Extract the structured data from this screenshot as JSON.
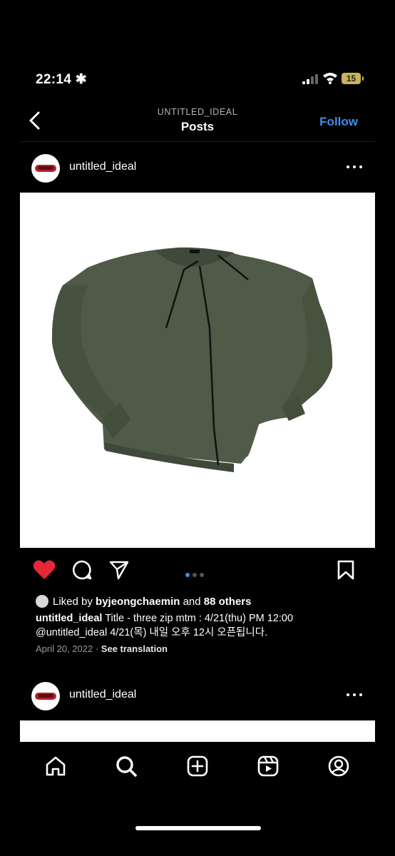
{
  "status_bar": {
    "time": "22:14",
    "battery": "15"
  },
  "header": {
    "account_label": "UNTITLED_IDEAL",
    "title": "Posts",
    "follow_label": "Follow"
  },
  "post": {
    "username": "untitled_ideal",
    "carousel": {
      "count": 3,
      "active_index": 0
    },
    "likes": {
      "prefix": "Liked by ",
      "liker": "byjeongchaemin",
      "middle": " and ",
      "others": "88 others"
    },
    "caption_user": "untitled_ideal",
    "caption_text": " Title - three zip mtm : 4/21(thu) PM 12:00",
    "caption_line2": "@untitled_ideal 4/21(목) 내일 오후 12시 오픈됩니다.",
    "date": "April 20, 2022",
    "separator": " · ",
    "see_translation": "See translation",
    "liked": true
  },
  "next_post": {
    "username": "untitled_ideal"
  },
  "tabs": [
    "home-icon",
    "search-icon",
    "create-icon",
    "reels-icon",
    "profile-icon"
  ],
  "colors": {
    "accent": "#3d8fe8",
    "like": "#e8263a",
    "sweater": "#4f5a48"
  }
}
